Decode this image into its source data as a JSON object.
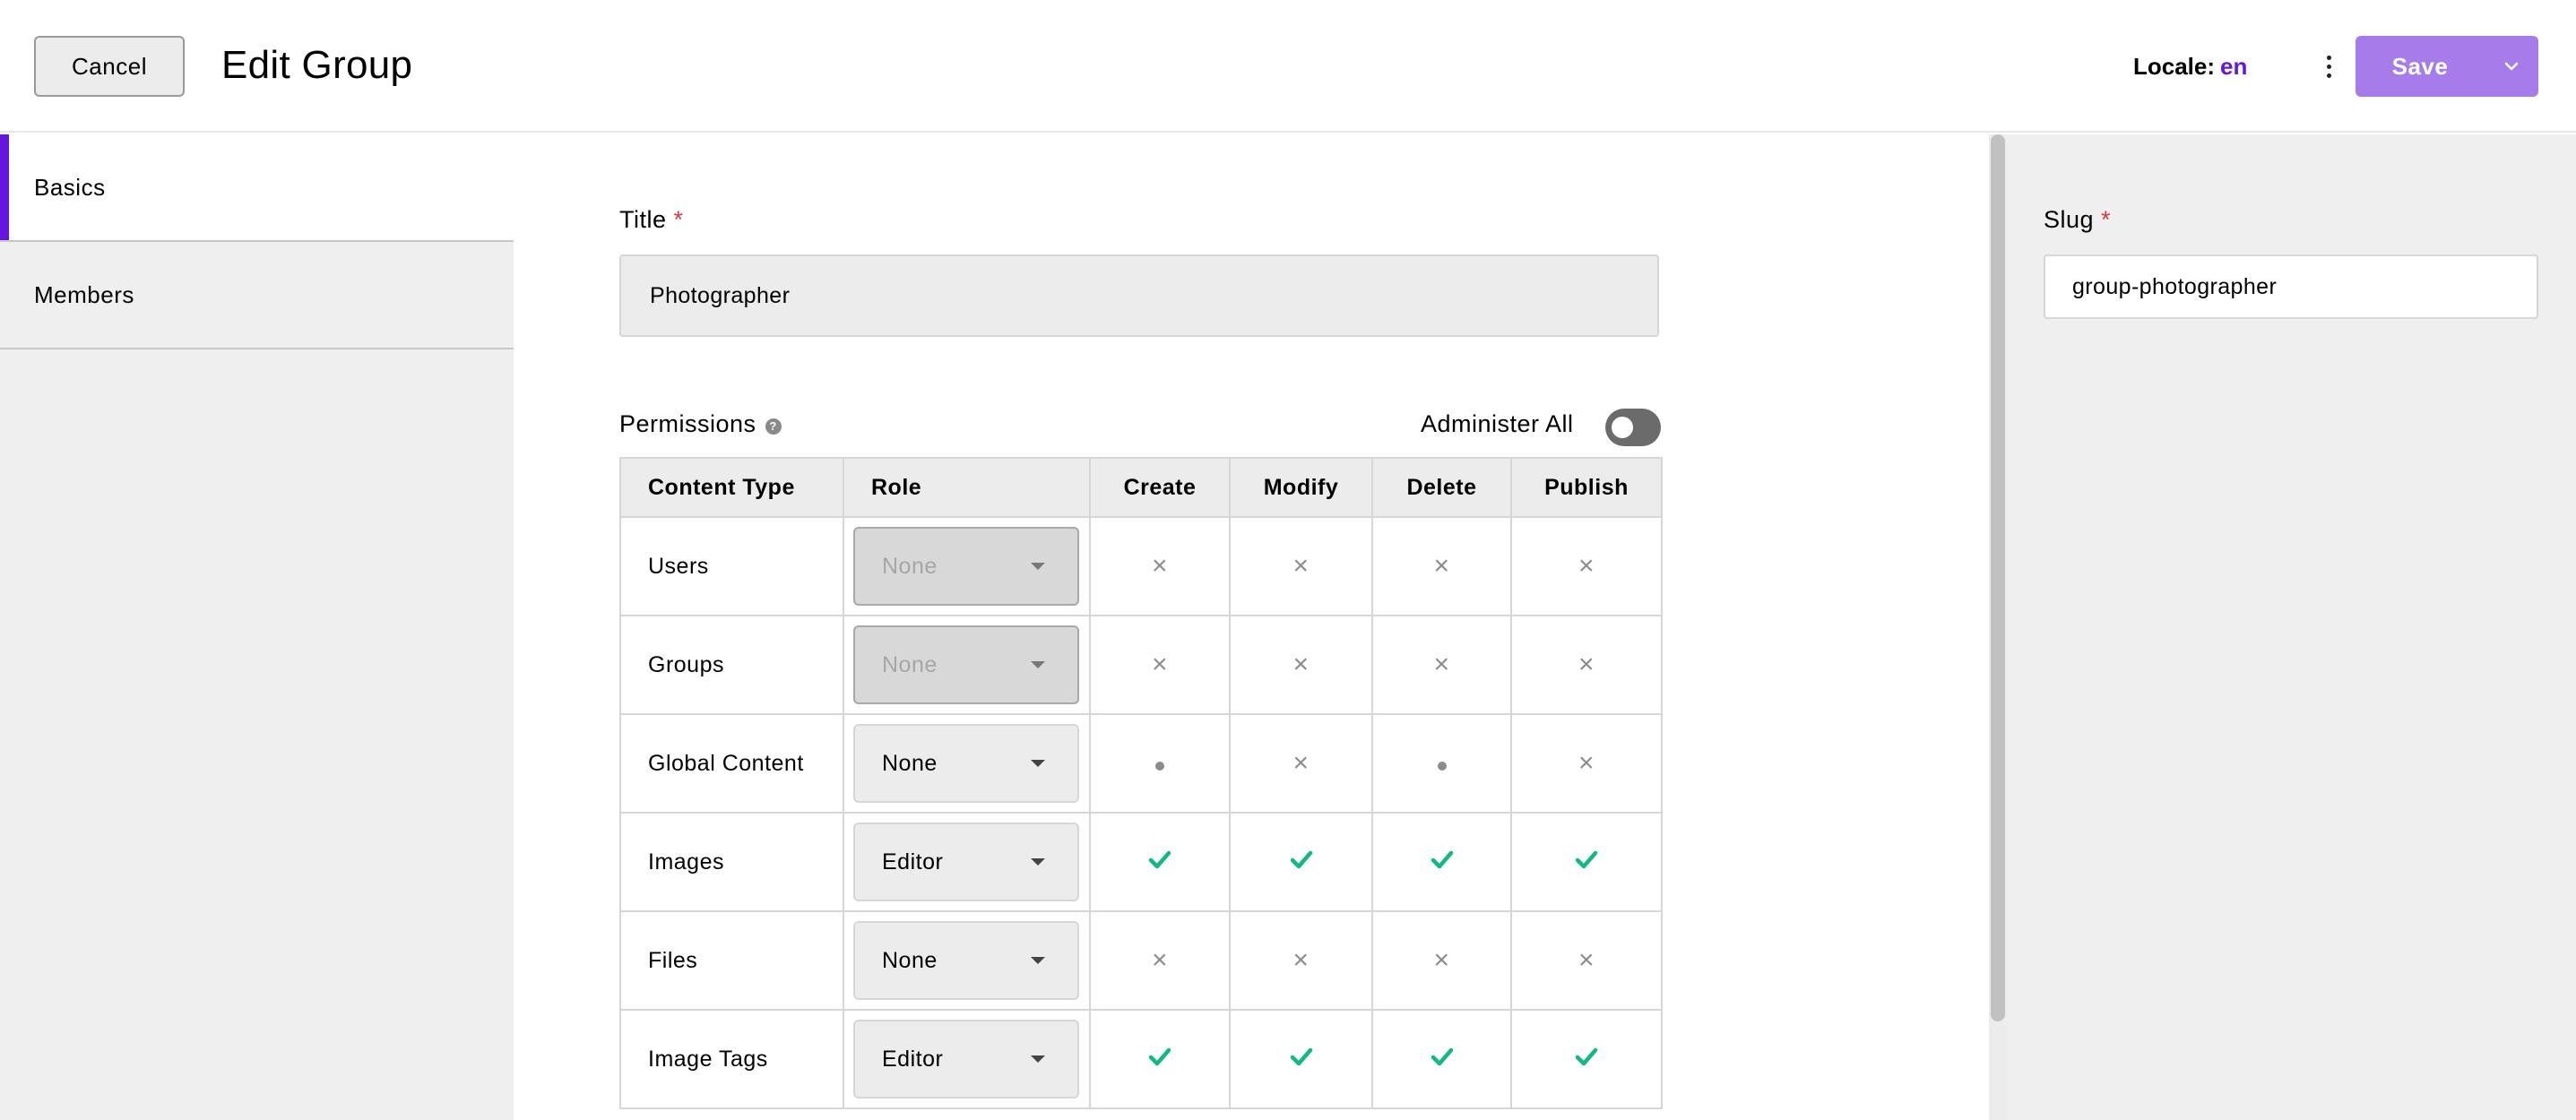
{
  "header": {
    "cancel_label": "Cancel",
    "title": "Edit Group",
    "locale_label": "Locale:",
    "locale_value": "en",
    "save_label": "Save"
  },
  "sidebar": {
    "items": [
      {
        "label": "Basics",
        "active": true
      },
      {
        "label": "Members",
        "active": false
      }
    ]
  },
  "form": {
    "title_label": "Title",
    "required_mark": "*",
    "title_value": "Photographer",
    "permissions_label": "Permissions",
    "help_glyph": "?",
    "administer_all_label": "Administer All",
    "administer_all_on": false
  },
  "permissions": {
    "columns": [
      "Content Type",
      "Role",
      "Create",
      "Modify",
      "Delete",
      "Publish"
    ],
    "rows": [
      {
        "type": "Users",
        "role": "None",
        "disabled": true,
        "create": "x",
        "modify": "x",
        "delete": "x",
        "publish": "x"
      },
      {
        "type": "Groups",
        "role": "None",
        "disabled": true,
        "create": "x",
        "modify": "x",
        "delete": "x",
        "publish": "x"
      },
      {
        "type": "Global Content",
        "role": "None",
        "disabled": false,
        "create": "dot",
        "modify": "x",
        "delete": "dot",
        "publish": "x"
      },
      {
        "type": "Images",
        "role": "Editor",
        "disabled": false,
        "create": "check",
        "modify": "check",
        "delete": "check",
        "publish": "check"
      },
      {
        "type": "Files",
        "role": "None",
        "disabled": false,
        "create": "x",
        "modify": "x",
        "delete": "x",
        "publish": "x"
      },
      {
        "type": "Image Tags",
        "role": "Editor",
        "disabled": false,
        "create": "check",
        "modify": "check",
        "delete": "check",
        "publish": "check"
      }
    ]
  },
  "right_panel": {
    "slug_label": "Slug",
    "slug_value": "group-photographer"
  },
  "colors": {
    "accent": "#6516dd",
    "save_button": "#a67cea",
    "check": "#12b886",
    "required": "#d83a3a"
  },
  "icons": {
    "x": "×",
    "check": "check-icon",
    "dot": "dot-icon",
    "more": "more-vertical-icon",
    "caret": "chevron-down-icon"
  }
}
